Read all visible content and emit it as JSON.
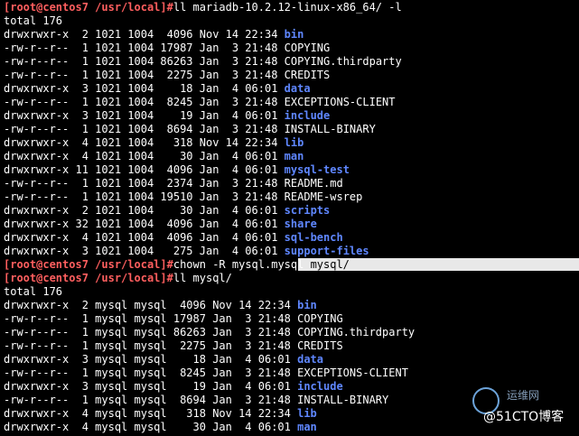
{
  "prompt": "[root@centos7 /usr/local]#",
  "commands": {
    "ls1": "ll mariadb-10.2.12-linux-x86_64/ -l",
    "chown": "chown -R mysql.mysql ",
    "chown_selected": "mysql/",
    "ls2": "ll mysql/"
  },
  "total1": "total 176",
  "total2": "total 176",
  "listing1": [
    {
      "meta": "drwxrwxr-x  2 1021 1004  4096 Nov 14 22:34 ",
      "name": "bin",
      "dir": true
    },
    {
      "meta": "-rw-r--r--  1 1021 1004 17987 Jan  3 21:48 ",
      "name": "COPYING",
      "dir": false
    },
    {
      "meta": "-rw-r--r--  1 1021 1004 86263 Jan  3 21:48 ",
      "name": "COPYING.thirdparty",
      "dir": false
    },
    {
      "meta": "-rw-r--r--  1 1021 1004  2275 Jan  3 21:48 ",
      "name": "CREDITS",
      "dir": false
    },
    {
      "meta": "drwxrwxr-x  3 1021 1004    18 Jan  4 06:01 ",
      "name": "data",
      "dir": true
    },
    {
      "meta": "-rw-r--r--  1 1021 1004  8245 Jan  3 21:48 ",
      "name": "EXCEPTIONS-CLIENT",
      "dir": false
    },
    {
      "meta": "drwxrwxr-x  3 1021 1004    19 Jan  4 06:01 ",
      "name": "include",
      "dir": true
    },
    {
      "meta": "-rw-r--r--  1 1021 1004  8694 Jan  3 21:48 ",
      "name": "INSTALL-BINARY",
      "dir": false
    },
    {
      "meta": "drwxrwxr-x  4 1021 1004   318 Nov 14 22:34 ",
      "name": "lib",
      "dir": true
    },
    {
      "meta": "drwxrwxr-x  4 1021 1004    30 Jan  4 06:01 ",
      "name": "man",
      "dir": true
    },
    {
      "meta": "drwxrwxr-x 11 1021 1004  4096 Jan  4 06:01 ",
      "name": "mysql-test",
      "dir": true
    },
    {
      "meta": "-rw-r--r--  1 1021 1004  2374 Jan  3 21:48 ",
      "name": "README.md",
      "dir": false
    },
    {
      "meta": "-rw-r--r--  1 1021 1004 19510 Jan  3 21:48 ",
      "name": "README-wsrep",
      "dir": false
    },
    {
      "meta": "drwxrwxr-x  2 1021 1004    30 Jan  4 06:01 ",
      "name": "scripts",
      "dir": true
    },
    {
      "meta": "drwxrwxr-x 32 1021 1004  4096 Jan  4 06:01 ",
      "name": "share",
      "dir": true
    },
    {
      "meta": "drwxrwxr-x  4 1021 1004  4096 Jan  4 06:01 ",
      "name": "sql-bench",
      "dir": true
    },
    {
      "meta": "drwxrwxr-x  3 1021 1004   275 Jan  4 06:01 ",
      "name": "support-files",
      "dir": true
    }
  ],
  "listing2": [
    {
      "meta": "drwxrwxr-x  2 mysql mysql  4096 Nov 14 22:34 ",
      "name": "bin",
      "dir": true
    },
    {
      "meta": "-rw-r--r--  1 mysql mysql 17987 Jan  3 21:48 ",
      "name": "COPYING",
      "dir": false
    },
    {
      "meta": "-rw-r--r--  1 mysql mysql 86263 Jan  3 21:48 ",
      "name": "COPYING.thirdparty",
      "dir": false
    },
    {
      "meta": "-rw-r--r--  1 mysql mysql  2275 Jan  3 21:48 ",
      "name": "CREDITS",
      "dir": false
    },
    {
      "meta": "drwxrwxr-x  3 mysql mysql    18 Jan  4 06:01 ",
      "name": "data",
      "dir": true
    },
    {
      "meta": "-rw-r--r--  1 mysql mysql  8245 Jan  3 21:48 ",
      "name": "EXCEPTIONS-CLIENT",
      "dir": false
    },
    {
      "meta": "drwxrwxr-x  3 mysql mysql    19 Jan  4 06:01 ",
      "name": "include",
      "dir": true
    },
    {
      "meta": "-rw-r--r--  1 mysql mysql  8694 Jan  3 21:48 ",
      "name": "INSTALL-BINARY",
      "dir": false
    },
    {
      "meta": "drwxrwxr-x  4 mysql mysql   318 Nov 14 22:34 ",
      "name": "lib",
      "dir": true
    },
    {
      "meta": "drwxrwxr-x  4 mysql mysql    30 Jan  4 06:01 ",
      "name": "man",
      "dir": true
    }
  ],
  "watermark": {
    "site": "运维网",
    "brand": "@51CTO博客"
  },
  "colors": {
    "background": "#000000",
    "prompt": "#ff5f5f",
    "directory": "#5f87ff",
    "text": "#ffffff",
    "selection": "#e8e8e8"
  }
}
